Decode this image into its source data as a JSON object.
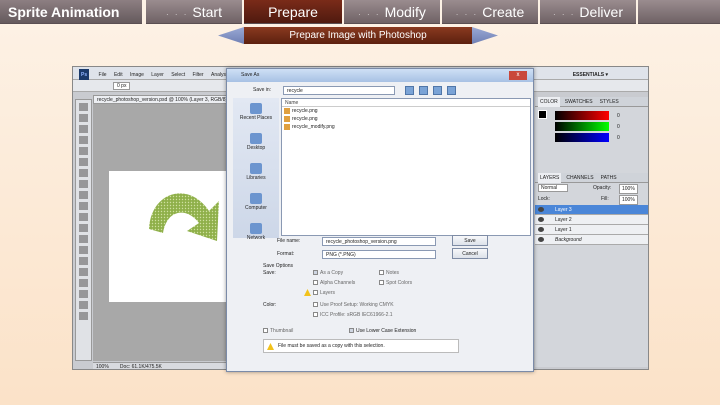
{
  "header": {
    "title": "Sprite Animation",
    "steps": [
      {
        "label": "Start",
        "state": "inactive"
      },
      {
        "label": "Prepare",
        "state": "active"
      },
      {
        "label": "Modify",
        "state": "inactive"
      },
      {
        "label": "Create",
        "state": "inactive"
      },
      {
        "label": "Deliver",
        "state": "inactive"
      }
    ],
    "step_dots": "· · ·"
  },
  "substep": {
    "label": "Prepare Image with Photoshop"
  },
  "colors": {
    "active_tab": "#6a2414",
    "inactive_tab": "#8a7c7f",
    "substep_bar": "#7a2f19",
    "arrows": "#8597c8",
    "background": "#fbe2c8"
  },
  "photoshop": {
    "menu": [
      "File",
      "Edit",
      "Image",
      "Layer",
      "Select",
      "Filter",
      "Analysis"
    ],
    "logo": "Ps",
    "options_value": "0 px",
    "doc_tab": "recycle_photoshop_version.psd @ 100% (Layer 3, RGB/8)",
    "workspace": "ESSENTIALS ▾",
    "status_zoom": "100%",
    "status_doc": "Doc: 61.1K/475.5K",
    "color_panel_tabs": [
      "COLOR",
      "SWATCHES",
      "STYLES"
    ],
    "color_values": [
      "0",
      "0",
      "0"
    ],
    "layers_tabs": [
      "LAYERS",
      "CHANNELS",
      "PATHS"
    ],
    "blend_mode": "Normal",
    "opacity_label": "Opacity:",
    "opacity_value": "100%",
    "lock_label": "Lock:",
    "fill_label": "Fill:",
    "fill_value": "100%",
    "layers": [
      {
        "name": "Layer 3",
        "selected": true
      },
      {
        "name": "Layer 2",
        "selected": false
      },
      {
        "name": "Layer 1",
        "selected": false
      },
      {
        "name": "Background",
        "selected": false
      }
    ]
  },
  "save_dialog": {
    "title": "Save As",
    "close": "x",
    "save_in_label": "Save in:",
    "save_in_value": "recycle",
    "places": [
      "Recent Places",
      "Desktop",
      "Libraries",
      "Computer",
      "Network"
    ],
    "list_header": "Name",
    "files": [
      "recycle.png",
      "recycle.png",
      "recycle_modify.png"
    ],
    "file_name_label": "File name:",
    "file_name_value": "recycle_photoshop_version.png",
    "format_label": "Format:",
    "format_value": "PNG (*.PNG)",
    "save_button": "Save",
    "cancel_button": "Cancel",
    "save_options_label": "Save Options",
    "save_label": "Save:",
    "options": {
      "as_copy": "As a Copy",
      "alpha": "Alpha Channels",
      "layers": "Layers",
      "notes": "Notes",
      "spot": "Spot Colors"
    },
    "color_label": "Color:",
    "proof_setup": "Use Proof Setup:  Working CMYK",
    "icc_profile": "ICC Profile:  sRGB IEC61966-2.1",
    "thumbnail": "Thumbnail",
    "lowercase": "Use Lower Case Extension",
    "warning": "File must be saved as a copy with this selection."
  }
}
